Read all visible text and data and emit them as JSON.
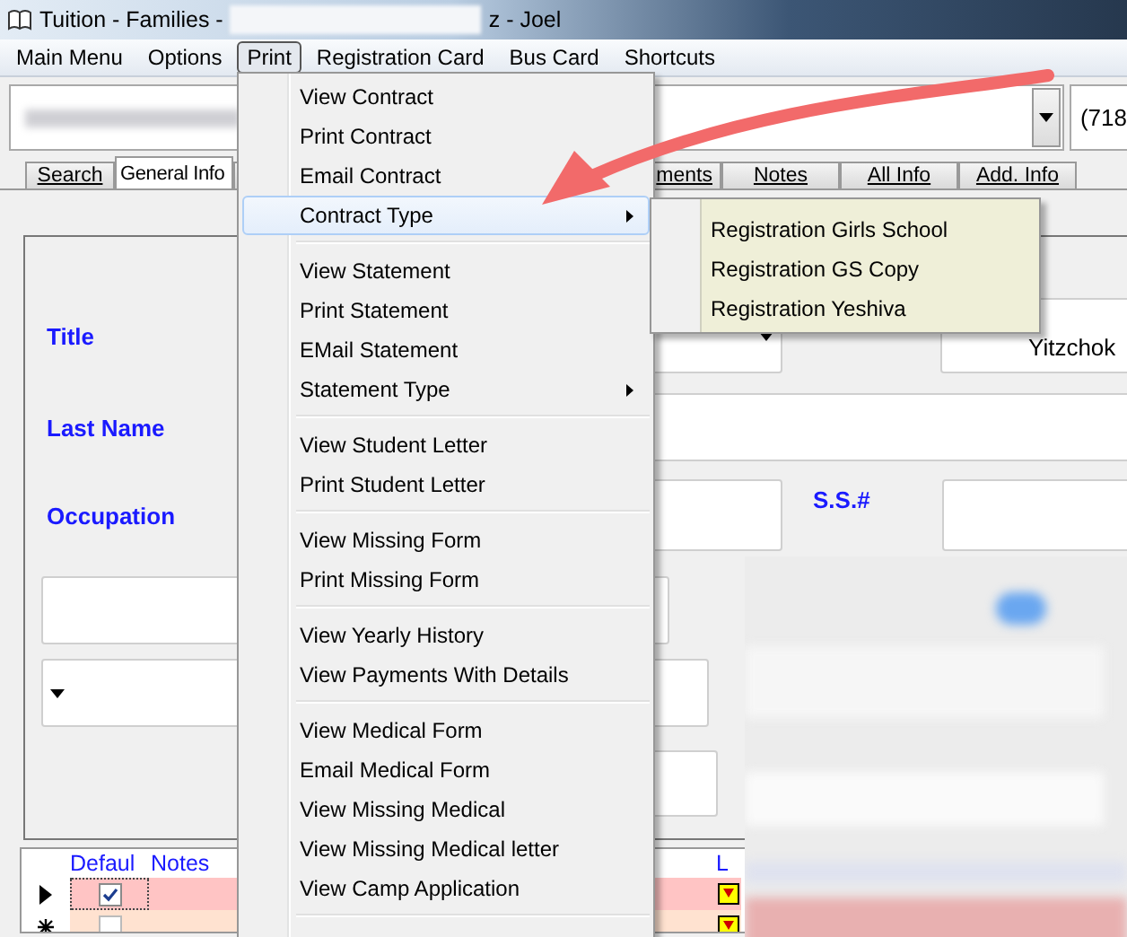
{
  "window": {
    "title_start": "Tuition - Families -",
    "title_end": "z - Joel"
  },
  "menu_bar": [
    {
      "label": "Main Menu",
      "selected": false
    },
    {
      "label": "Options",
      "selected": false
    },
    {
      "label": "Print",
      "selected": true
    },
    {
      "label": "Registration Card",
      "selected": false
    },
    {
      "label": "Bus Card",
      "selected": false
    },
    {
      "label": "Shortcuts",
      "selected": false
    }
  ],
  "phone_field": {
    "value": "(718"
  },
  "tabs": [
    {
      "label": "Search",
      "selected": false
    },
    {
      "label": "General Info",
      "selected": true
    },
    {
      "label": "ments",
      "selected": false
    },
    {
      "label": "Notes",
      "selected": false
    },
    {
      "label": "All Info",
      "selected": false
    },
    {
      "label": "Add. Info",
      "selected": false
    }
  ],
  "form": {
    "title_label": "Title",
    "last_name_label": "Last Name",
    "occupation_label": "Occupation",
    "ssn_label": "S.S.#",
    "first_name_value": "Yitzchok"
  },
  "print_menu": [
    [
      {
        "label": "View Contract",
        "selected": false,
        "submenu": false
      },
      {
        "label": "Print Contract",
        "selected": false,
        "submenu": false
      },
      {
        "label": "Email Contract",
        "selected": false,
        "submenu": false
      },
      {
        "label": "Contract Type",
        "selected": true,
        "submenu": true
      }
    ],
    [
      {
        "label": "View Statement",
        "selected": false,
        "submenu": false
      },
      {
        "label": "Print Statement",
        "selected": false,
        "submenu": false
      },
      {
        "label": "EMail Statement",
        "selected": false,
        "submenu": false
      },
      {
        "label": "Statement Type",
        "selected": false,
        "submenu": true
      }
    ],
    [
      {
        "label": "View Student Letter",
        "selected": false,
        "submenu": false
      },
      {
        "label": "Print Student Letter",
        "selected": false,
        "submenu": false
      }
    ],
    [
      {
        "label": "View Missing Form",
        "selected": false,
        "submenu": false
      },
      {
        "label": "Print Missing Form",
        "selected": false,
        "submenu": false
      }
    ],
    [
      {
        "label": "View Yearly History",
        "selected": false,
        "submenu": false
      },
      {
        "label": "View Payments With Details",
        "selected": false,
        "submenu": false
      }
    ],
    [
      {
        "label": "View Medical Form",
        "selected": false,
        "submenu": false
      },
      {
        "label": "Email Medical Form",
        "selected": false,
        "submenu": false
      },
      {
        "label": "View Missing Medical",
        "selected": false,
        "submenu": false
      },
      {
        "label": "View Missing Medical letter",
        "selected": false,
        "submenu": false
      },
      {
        "label": "View Camp Application",
        "selected": false,
        "submenu": false
      }
    ]
  ],
  "submenu": [
    "Registration Girls School",
    "Registration GS Copy",
    "Registration Yeshiva"
  ],
  "grid": {
    "columns": [
      "Defaul",
      "Notes",
      "L"
    ],
    "rows": [
      {
        "current": true,
        "default": true
      },
      {
        "current": false,
        "default": false
      }
    ]
  }
}
